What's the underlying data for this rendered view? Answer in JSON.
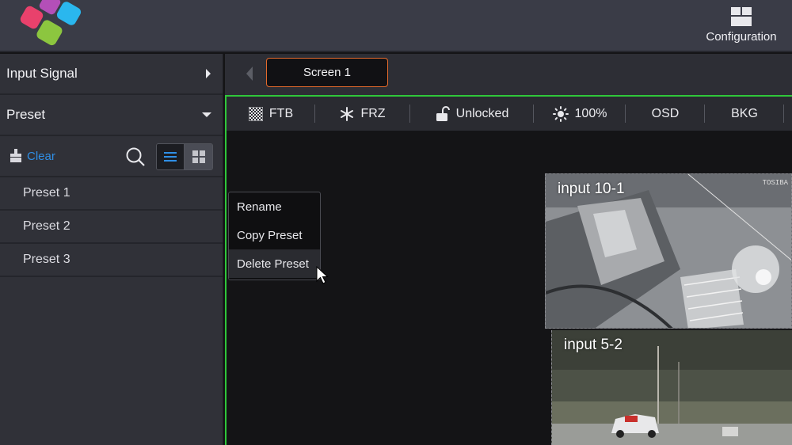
{
  "header": {
    "config_label": "Configuration"
  },
  "sidebar": {
    "input_signal_label": "Input Signal",
    "preset_label": "Preset",
    "clear_label": "Clear",
    "presets": [
      {
        "label": "Preset 1"
      },
      {
        "label": "Preset 2"
      },
      {
        "label": "Preset 3"
      }
    ]
  },
  "tabs": {
    "active_tab": "Screen 1"
  },
  "toolbar": {
    "ftb": "FTB",
    "frz": "FRZ",
    "lock": "Unlocked",
    "brightness": "100%",
    "osd": "OSD",
    "bkg": "BKG"
  },
  "context_menu": {
    "items": [
      {
        "label": "Rename"
      },
      {
        "label": "Copy Preset"
      },
      {
        "label": "Delete Preset"
      }
    ],
    "hovered_item": "Delete Preset"
  },
  "windows": [
    {
      "label": "input 10-1",
      "stamp": "TOSIBA"
    },
    {
      "label": "input 5-2"
    }
  ],
  "colors": {
    "accent_blue": "#2f8fe6",
    "active_tab_border": "#e46a2c",
    "screen_border": "#2fc73a"
  },
  "icons": {
    "logo": "brand-logo",
    "config": "layout-grid-icon",
    "expand": "caret-right-icon",
    "collapse": "caret-down-icon",
    "clear": "brush-icon",
    "search": "search-icon",
    "list_view": "list-icon",
    "grid_view": "grid-icon",
    "ftb": "checker-icon",
    "frz": "snowflake-icon",
    "lock": "unlock-icon",
    "brightness": "sun-icon"
  }
}
